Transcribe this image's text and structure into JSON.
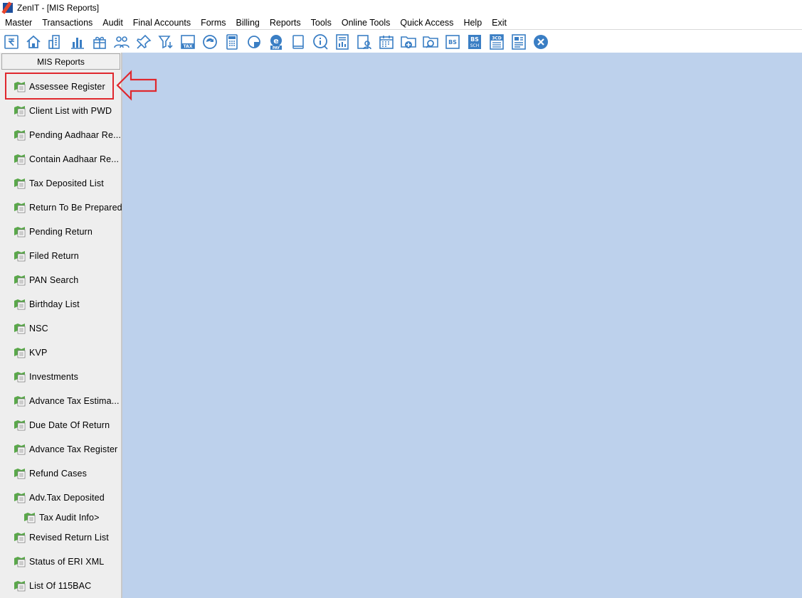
{
  "window": {
    "title": "ZenIT - [MIS Reports]"
  },
  "menu": [
    "Master",
    "Transactions",
    "Audit",
    "Final Accounts",
    "Forms",
    "Billing",
    "Reports",
    "Tools",
    "Online Tools",
    "Quick Access",
    "Help",
    "Exit"
  ],
  "toolbar": {
    "icons": [
      "rupee-book-icon",
      "home-icon",
      "building-icon",
      "bar-chart-icon",
      "gift-icon",
      "users-icon",
      "pin-icon",
      "filter-icon",
      "tax-icon",
      "refresh-icon",
      "calculator-icon",
      "pie-icon",
      "epay-icon",
      "book-icon",
      "info-icon",
      "report-icon",
      "contact-icon",
      "calendar-icon",
      "folder-add-icon",
      "folder-search-icon",
      "bs-icon",
      "bs-sch-icon",
      "3cd-icon",
      "form-icon",
      "close-circle-icon"
    ],
    "labels": {
      "tax": "TAX",
      "pay": "PAY",
      "e": "e",
      "bs": "BS",
      "bs2": "BS",
      "sch": "SCH",
      "cd": "3CD"
    }
  },
  "sidebar": {
    "header": "MIS Reports",
    "items": [
      {
        "label": "Assessee Register",
        "sub": false
      },
      {
        "label": "Client List with PWD",
        "sub": false
      },
      {
        "label": "Pending Aadhaar Re...",
        "sub": false
      },
      {
        "label": "Contain Aadhaar Re...",
        "sub": false
      },
      {
        "label": "Tax Deposited List",
        "sub": false
      },
      {
        "label": "Return To Be Prepared",
        "sub": false
      },
      {
        "label": "Pending Return",
        "sub": false
      },
      {
        "label": "Filed Return",
        "sub": false
      },
      {
        "label": "PAN Search",
        "sub": false
      },
      {
        "label": "Birthday List",
        "sub": false
      },
      {
        "label": "NSC",
        "sub": false
      },
      {
        "label": "KVP",
        "sub": false
      },
      {
        "label": "Investments",
        "sub": false
      },
      {
        "label": "Advance Tax Estima...",
        "sub": false
      },
      {
        "label": "Due Date Of Return",
        "sub": false
      },
      {
        "label": "Advance Tax Register",
        "sub": false
      },
      {
        "label": "Refund Cases",
        "sub": false
      },
      {
        "label": "Adv.Tax Deposited",
        "sub": false
      },
      {
        "label": "Tax Audit Info>",
        "sub": true
      },
      {
        "label": "Revised Return List",
        "sub": false
      },
      {
        "label": "Status of ERI XML",
        "sub": false
      },
      {
        "label": "List Of 115BAC",
        "sub": false
      }
    ]
  },
  "colors": {
    "workspace": "#bdd1ec",
    "accent": "#3a7ec4",
    "highlight": "#e0282e",
    "icon_green": "#5aa84a"
  }
}
